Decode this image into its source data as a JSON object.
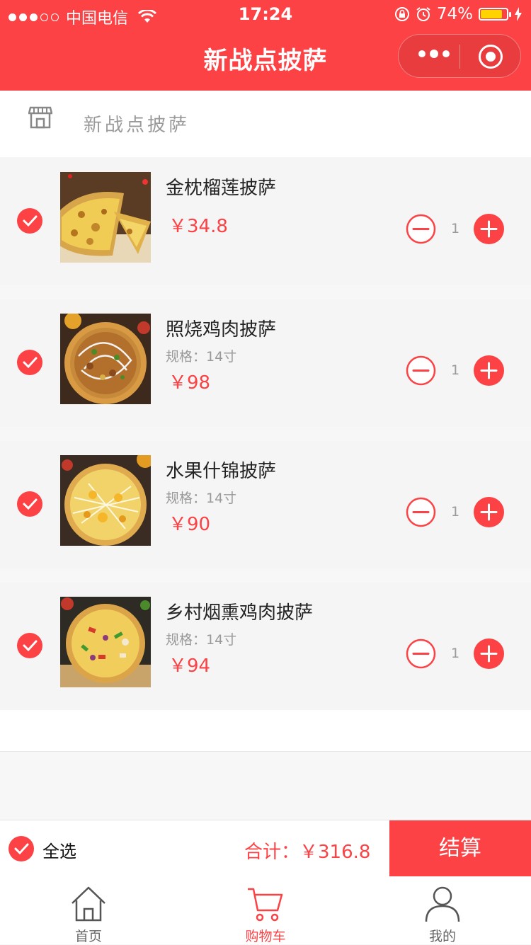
{
  "status_bar": {
    "carrier": "中国电信",
    "time": "17:24",
    "battery": "74%"
  },
  "nav": {
    "title": "新战点披萨"
  },
  "shop": {
    "name": "新战点披萨"
  },
  "cart": {
    "items": [
      {
        "name": "金枕榴莲披萨",
        "spec": "",
        "price": "￥34.8",
        "qty": "1"
      },
      {
        "name": "照烧鸡肉披萨",
        "spec": "规格：14寸",
        "price": "￥98",
        "qty": "1"
      },
      {
        "name": "水果什锦披萨",
        "spec": "规格：14寸",
        "price": "￥90",
        "qty": "1"
      },
      {
        "name": "乡村烟熏鸡肉披萨",
        "spec": "规格：14寸",
        "price": "￥94",
        "qty": "1"
      }
    ],
    "select_all_label": "全选",
    "total_label": "合计：",
    "total_value": "￥316.8",
    "checkout_label": "结算"
  },
  "tabs": [
    {
      "label": "首页",
      "icon": "home-icon"
    },
    {
      "label": "购物车",
      "icon": "cart-icon",
      "active": true
    },
    {
      "label": "我的",
      "icon": "user-icon"
    }
  ],
  "colors": {
    "accent": "#fc4245",
    "battery": "#ffd300"
  }
}
